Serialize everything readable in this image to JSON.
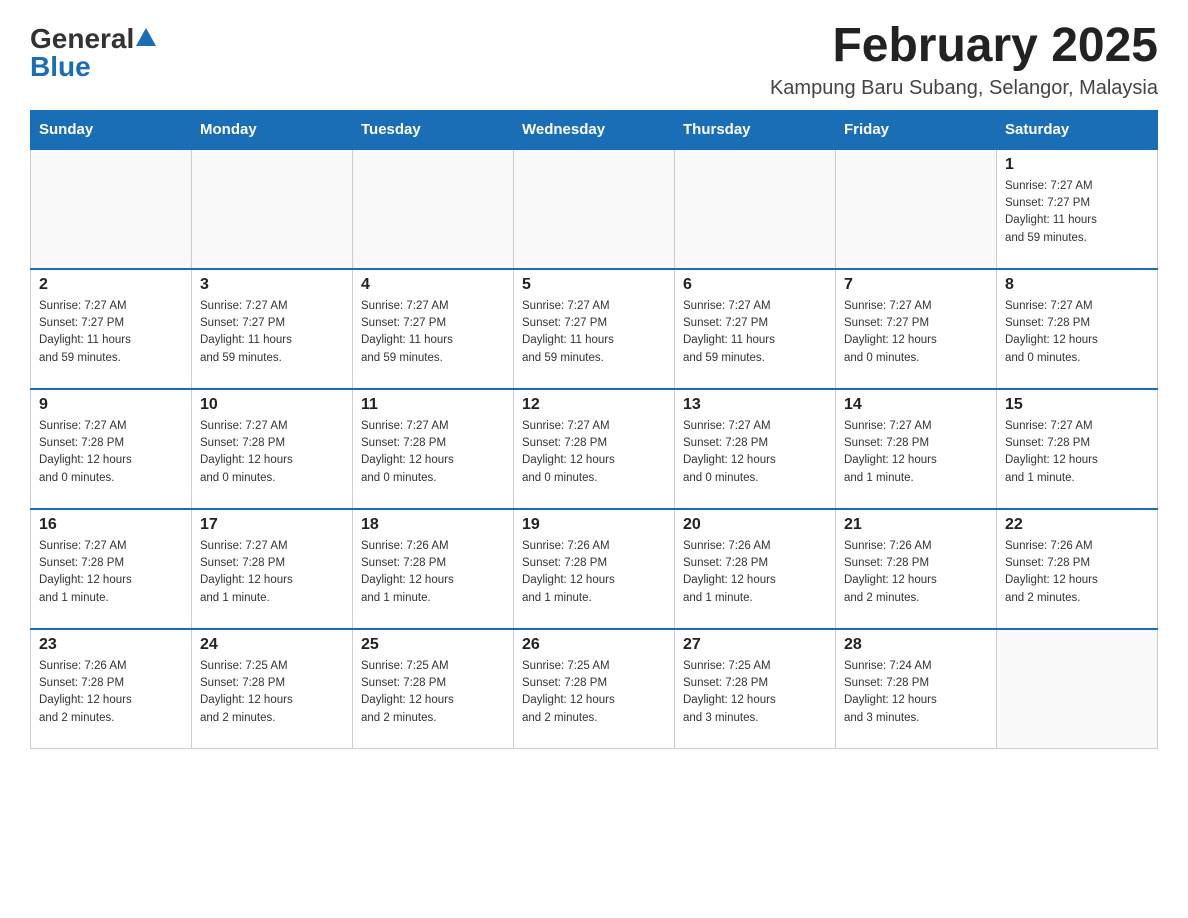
{
  "logo": {
    "general": "General",
    "blue": "Blue"
  },
  "title": "February 2025",
  "location": "Kampung Baru Subang, Selangor, Malaysia",
  "days_of_week": [
    "Sunday",
    "Monday",
    "Tuesday",
    "Wednesday",
    "Thursday",
    "Friday",
    "Saturday"
  ],
  "weeks": [
    [
      {
        "day": "",
        "info": ""
      },
      {
        "day": "",
        "info": ""
      },
      {
        "day": "",
        "info": ""
      },
      {
        "day": "",
        "info": ""
      },
      {
        "day": "",
        "info": ""
      },
      {
        "day": "",
        "info": ""
      },
      {
        "day": "1",
        "info": "Sunrise: 7:27 AM\nSunset: 7:27 PM\nDaylight: 11 hours\nand 59 minutes."
      }
    ],
    [
      {
        "day": "2",
        "info": "Sunrise: 7:27 AM\nSunset: 7:27 PM\nDaylight: 11 hours\nand 59 minutes."
      },
      {
        "day": "3",
        "info": "Sunrise: 7:27 AM\nSunset: 7:27 PM\nDaylight: 11 hours\nand 59 minutes."
      },
      {
        "day": "4",
        "info": "Sunrise: 7:27 AM\nSunset: 7:27 PM\nDaylight: 11 hours\nand 59 minutes."
      },
      {
        "day": "5",
        "info": "Sunrise: 7:27 AM\nSunset: 7:27 PM\nDaylight: 11 hours\nand 59 minutes."
      },
      {
        "day": "6",
        "info": "Sunrise: 7:27 AM\nSunset: 7:27 PM\nDaylight: 11 hours\nand 59 minutes."
      },
      {
        "day": "7",
        "info": "Sunrise: 7:27 AM\nSunset: 7:27 PM\nDaylight: 12 hours\nand 0 minutes."
      },
      {
        "day": "8",
        "info": "Sunrise: 7:27 AM\nSunset: 7:28 PM\nDaylight: 12 hours\nand 0 minutes."
      }
    ],
    [
      {
        "day": "9",
        "info": "Sunrise: 7:27 AM\nSunset: 7:28 PM\nDaylight: 12 hours\nand 0 minutes."
      },
      {
        "day": "10",
        "info": "Sunrise: 7:27 AM\nSunset: 7:28 PM\nDaylight: 12 hours\nand 0 minutes."
      },
      {
        "day": "11",
        "info": "Sunrise: 7:27 AM\nSunset: 7:28 PM\nDaylight: 12 hours\nand 0 minutes."
      },
      {
        "day": "12",
        "info": "Sunrise: 7:27 AM\nSunset: 7:28 PM\nDaylight: 12 hours\nand 0 minutes."
      },
      {
        "day": "13",
        "info": "Sunrise: 7:27 AM\nSunset: 7:28 PM\nDaylight: 12 hours\nand 0 minutes."
      },
      {
        "day": "14",
        "info": "Sunrise: 7:27 AM\nSunset: 7:28 PM\nDaylight: 12 hours\nand 1 minute."
      },
      {
        "day": "15",
        "info": "Sunrise: 7:27 AM\nSunset: 7:28 PM\nDaylight: 12 hours\nand 1 minute."
      }
    ],
    [
      {
        "day": "16",
        "info": "Sunrise: 7:27 AM\nSunset: 7:28 PM\nDaylight: 12 hours\nand 1 minute."
      },
      {
        "day": "17",
        "info": "Sunrise: 7:27 AM\nSunset: 7:28 PM\nDaylight: 12 hours\nand 1 minute."
      },
      {
        "day": "18",
        "info": "Sunrise: 7:26 AM\nSunset: 7:28 PM\nDaylight: 12 hours\nand 1 minute."
      },
      {
        "day": "19",
        "info": "Sunrise: 7:26 AM\nSunset: 7:28 PM\nDaylight: 12 hours\nand 1 minute."
      },
      {
        "day": "20",
        "info": "Sunrise: 7:26 AM\nSunset: 7:28 PM\nDaylight: 12 hours\nand 1 minute."
      },
      {
        "day": "21",
        "info": "Sunrise: 7:26 AM\nSunset: 7:28 PM\nDaylight: 12 hours\nand 2 minutes."
      },
      {
        "day": "22",
        "info": "Sunrise: 7:26 AM\nSunset: 7:28 PM\nDaylight: 12 hours\nand 2 minutes."
      }
    ],
    [
      {
        "day": "23",
        "info": "Sunrise: 7:26 AM\nSunset: 7:28 PM\nDaylight: 12 hours\nand 2 minutes."
      },
      {
        "day": "24",
        "info": "Sunrise: 7:25 AM\nSunset: 7:28 PM\nDaylight: 12 hours\nand 2 minutes."
      },
      {
        "day": "25",
        "info": "Sunrise: 7:25 AM\nSunset: 7:28 PM\nDaylight: 12 hours\nand 2 minutes."
      },
      {
        "day": "26",
        "info": "Sunrise: 7:25 AM\nSunset: 7:28 PM\nDaylight: 12 hours\nand 2 minutes."
      },
      {
        "day": "27",
        "info": "Sunrise: 7:25 AM\nSunset: 7:28 PM\nDaylight: 12 hours\nand 3 minutes."
      },
      {
        "day": "28",
        "info": "Sunrise: 7:24 AM\nSunset: 7:28 PM\nDaylight: 12 hours\nand 3 minutes."
      },
      {
        "day": "",
        "info": ""
      }
    ]
  ]
}
